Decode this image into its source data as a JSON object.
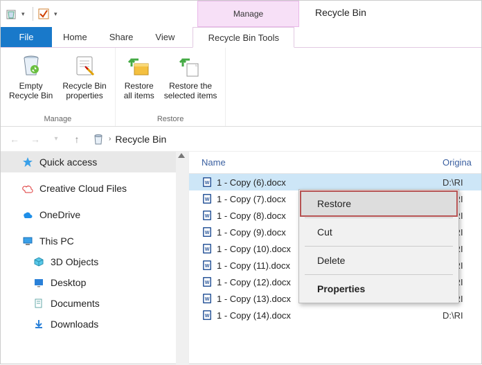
{
  "title": "Recycle Bin",
  "contextual_tab_label": "Manage",
  "tabs": {
    "file": "File",
    "home": "Home",
    "share": "Share",
    "view": "View",
    "tools": "Recycle Bin Tools"
  },
  "ribbon": {
    "groups": [
      {
        "label": "Manage",
        "buttons": [
          {
            "line1": "Empty",
            "line2": "Recycle Bin"
          },
          {
            "line1": "Recycle Bin",
            "line2": "properties"
          }
        ]
      },
      {
        "label": "Restore",
        "buttons": [
          {
            "line1": "Restore",
            "line2": "all items"
          },
          {
            "line1": "Restore the",
            "line2": "selected items"
          }
        ]
      }
    ]
  },
  "breadcrumb": {
    "location": "Recycle Bin"
  },
  "nav_pane": {
    "quick_access": "Quick access",
    "creative_cloud": "Creative Cloud Files",
    "onedrive": "OneDrive",
    "this_pc": "This PC",
    "children": {
      "objects3d": "3D Objects",
      "desktop": "Desktop",
      "documents": "Documents",
      "downloads": "Downloads"
    }
  },
  "columns": {
    "name": "Name",
    "original": "Origina"
  },
  "files": [
    {
      "name": "1 - Copy (6).docx",
      "orig": "D:\\RI",
      "selected": true
    },
    {
      "name": "1 - Copy (7).docx",
      "orig": "D:\\RI",
      "selected": false
    },
    {
      "name": "1 - Copy (8).docx",
      "orig": "D:\\RI",
      "selected": false
    },
    {
      "name": "1 - Copy (9).docx",
      "orig": "D:\\RI",
      "selected": false
    },
    {
      "name": "1 - Copy (10).docx",
      "orig": "D:\\RI",
      "selected": false
    },
    {
      "name": "1 - Copy (11).docx",
      "orig": "D:\\RI",
      "selected": false
    },
    {
      "name": "1 - Copy (12).docx",
      "orig": "D:\\RI",
      "selected": false
    },
    {
      "name": "1 - Copy (13).docx",
      "orig": "D:\\RI",
      "selected": false
    },
    {
      "name": "1 - Copy (14).docx",
      "orig": "D:\\RI",
      "selected": false
    }
  ],
  "context_menu": {
    "restore": "Restore",
    "cut": "Cut",
    "delete": "Delete",
    "properties": "Properties"
  }
}
